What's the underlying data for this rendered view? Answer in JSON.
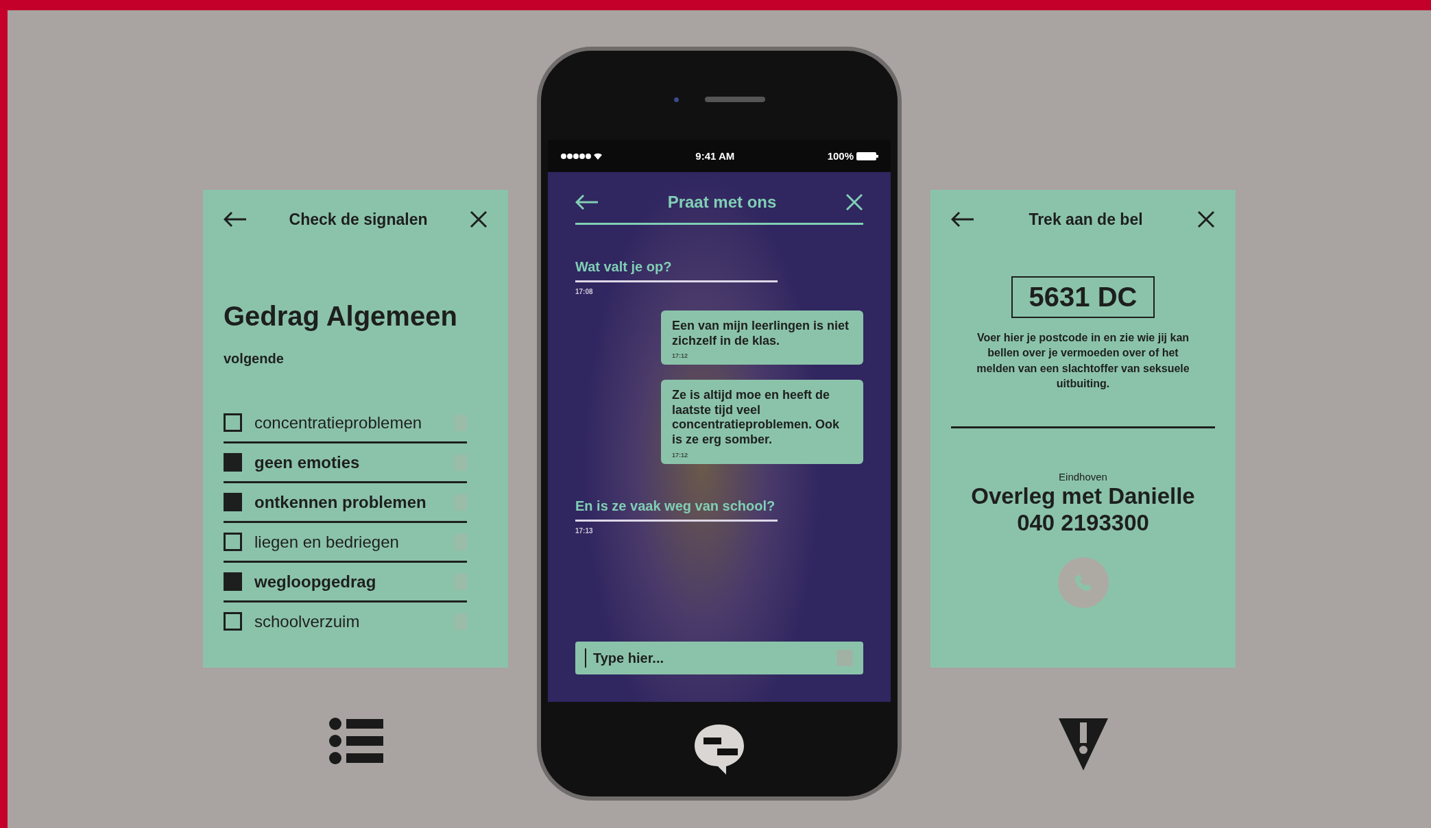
{
  "checklist_panel": {
    "title": "Check de signalen",
    "heading": "Gedrag Algemeen",
    "next_link": "volgende",
    "items": [
      {
        "label": "concentratieproblemen",
        "checked": false
      },
      {
        "label": "geen emoties",
        "checked": true
      },
      {
        "label": "ontkennen problemen",
        "checked": true
      },
      {
        "label": "liegen en bedriegen",
        "checked": false
      },
      {
        "label": "wegloopgedrag",
        "checked": true
      },
      {
        "label": "schoolverzuim",
        "checked": false
      }
    ]
  },
  "phone": {
    "status_bar": {
      "time": "9:41 AM",
      "battery": "100%"
    },
    "chat_title": "Praat met ons",
    "messages": [
      {
        "kind": "question",
        "text": "Wat valt je op?",
        "time": "17:08"
      },
      {
        "kind": "answer",
        "text": "Een van mijn leerlingen is niet zichzelf in de klas.",
        "time": "17:12"
      },
      {
        "kind": "answer",
        "text": "Ze is altijd moe en heeft de laatste tijd veel concentratieproblemen. Ook is ze erg somber.",
        "time": "17:12"
      },
      {
        "kind": "question",
        "text": "En is ze vaak weg van school?",
        "time": "17:13"
      }
    ],
    "input": {
      "placeholder": "Type hier..."
    }
  },
  "contact_panel": {
    "title": "Trek aan de bel",
    "postcode": "5631 DC",
    "description": "Voer hier je postcode in en zie wie jij kan bellen over je vermoeden over of het melden van een slachtoffer van seksuele uitbuiting.",
    "city": "Eindhoven",
    "contact_name": "Overleg met Danielle",
    "phone_number": "040 2193300"
  }
}
